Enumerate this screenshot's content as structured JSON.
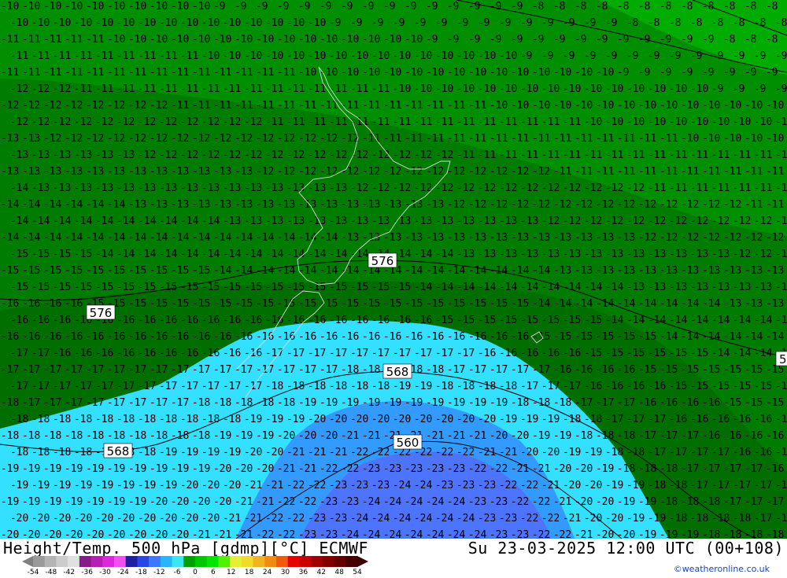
{
  "title": "Height/Temp. 500 hPa [gdmp][°C] ECMWF",
  "datetime": "Su 23-03-2025 12:00 UTC (00+108)",
  "credit": "©weatheronline.co.uk",
  "height_contour_labels": [
    "576",
    "576",
    "568",
    "568",
    "560",
    "5"
  ],
  "temperature_bands": [
    {
      "temp": "-8",
      "color": "#00aa00"
    },
    {
      "temp": "-9..-11",
      "color": "#009600"
    },
    {
      "temp": "-12..-14",
      "color": "#007a00"
    },
    {
      "temp": "-15",
      "color": "#008a00"
    },
    {
      "temp": "-16..-17",
      "color": "#33ddff"
    },
    {
      "temp": "-18..-19",
      "color": "#3399ff"
    },
    {
      "temp": "-20..-23",
      "color": "#4a77ff"
    }
  ],
  "colorbar": {
    "ticks": [
      "-54",
      "-48",
      "-42",
      "-36",
      "-30",
      "-24",
      "-18",
      "-12",
      "-6",
      "0",
      "6",
      "12",
      "18",
      "24",
      "30",
      "36",
      "42",
      "48",
      "54"
    ],
    "colors": [
      "#9a9a9a",
      "#b4b4b4",
      "#cccccc",
      "#e0e0e0",
      "#8a1a8a",
      "#b41eb4",
      "#dc28dc",
      "#f050f0",
      "#1e1ea0",
      "#2846e6",
      "#3c78ff",
      "#28b4ff",
      "#3ce6f0",
      "#00a000",
      "#00c800",
      "#00e600",
      "#50f000",
      "#e6f032",
      "#f0dc28",
      "#f0b41e",
      "#f08c14",
      "#f05a0a",
      "#e60000",
      "#c80000",
      "#a00000",
      "#820000",
      "#640000",
      "#460000"
    ]
  }
}
